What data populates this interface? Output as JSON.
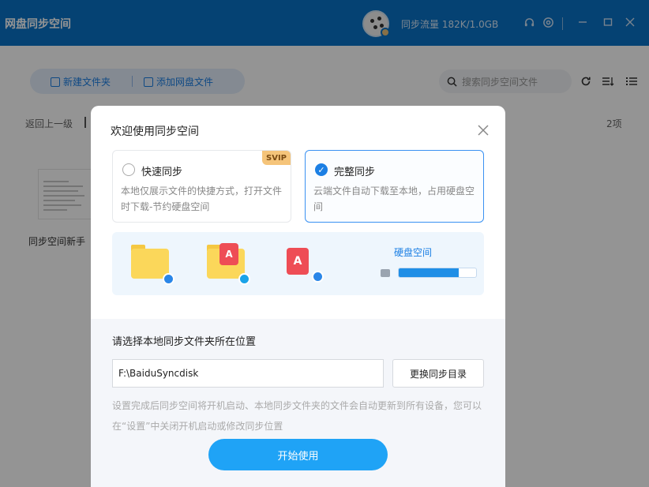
{
  "titlebar": {
    "title": "网盘同步空间",
    "traffic": "同步流量 182K/1.0GB",
    "icons": [
      "headset-icon",
      "gear-icon",
      "minimize-icon",
      "maximize-icon",
      "close-icon"
    ]
  },
  "toolbar": {
    "new_folder": "新建文件夹",
    "add_cloud_file": "添加网盘文件",
    "search_placeholder": "搜索同步空间文件",
    "right_icons": [
      "refresh-icon",
      "sort-icon",
      "list-view-icon"
    ]
  },
  "nav": {
    "back": "返回上一级",
    "count": "2项"
  },
  "files": [
    {
      "name": "同步空间新手"
    }
  ],
  "dialog": {
    "title": "欢迎使用同步空间",
    "options": [
      {
        "title": "快速同步",
        "badge": "SVIP",
        "desc": "本地仅展示文件的快捷方式，打开文件时下载-节约硬盘空间",
        "selected": false
      },
      {
        "title": "完整同步",
        "desc": "云端文件自动下载至本地，占用硬盘空间",
        "selected": true
      }
    ],
    "illustration": {
      "disk_label": "硬盘空间",
      "disk_fill": 0.78
    },
    "path_label": "请选择本地同步文件夹所在位置",
    "path_value": "F:\\BaiduSyncdisk",
    "change_button": "更换同步目录",
    "note": "设置完成后同步空间将开机启动、本地同步文件夹的文件会自动更新到所有设备，您可以在“设置”中关闭开机启动或修改同步位置",
    "start_button": "开始使用"
  },
  "colors": {
    "titlebar": "#0a72c7",
    "accent": "#1b7fe4",
    "start_button": "#1fa3f6",
    "svip": "#f5c47a"
  }
}
